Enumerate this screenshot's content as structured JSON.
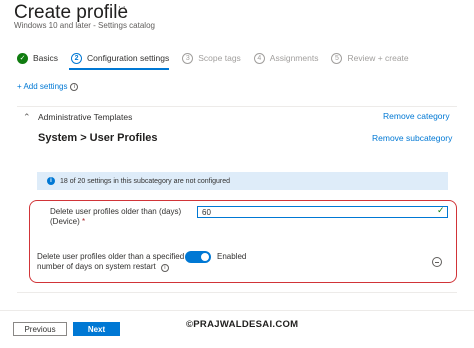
{
  "header": {
    "title": "Create profile",
    "more": "···",
    "subtitle": "Windows 10 and later - Settings catalog"
  },
  "steps": [
    {
      "num": "✓",
      "label": "Basics",
      "state": "done"
    },
    {
      "num": "2",
      "label": "Configuration settings",
      "state": "active"
    },
    {
      "num": "3",
      "label": "Scope tags",
      "state": "todo"
    },
    {
      "num": "4",
      "label": "Assignments",
      "state": "todo"
    },
    {
      "num": "5",
      "label": "Review + create",
      "state": "todo"
    }
  ],
  "add_settings": {
    "label": "+ Add settings",
    "info_glyph": "i"
  },
  "category": {
    "chevron": "⌃",
    "label": "Administrative Templates",
    "remove_label": "Remove category"
  },
  "subcategory": {
    "title": "System > User Profiles",
    "remove_label": "Remove subcategory"
  },
  "info_bar": {
    "glyph": "i",
    "text": "18 of 20 settings in this subcategory are not configured"
  },
  "settings": {
    "delete_days": {
      "label": "Delete user profiles older than (days) (Device)",
      "required_mark": "*",
      "value": "60",
      "valid_glyph": "✓"
    },
    "delete_on_restart": {
      "label": "Delete user profiles older than a specified number of days on system restart",
      "info_glyph": "i",
      "state_label": "Enabled",
      "enabled": true
    }
  },
  "footer": {
    "previous_label": "Previous",
    "next_label": "Next"
  },
  "watermark": "©PRAJWALDESAI.COM",
  "colors": {
    "accent": "#0078d4",
    "success": "#107c10",
    "highlight": "#d13438",
    "info_bg": "#deecf9"
  }
}
